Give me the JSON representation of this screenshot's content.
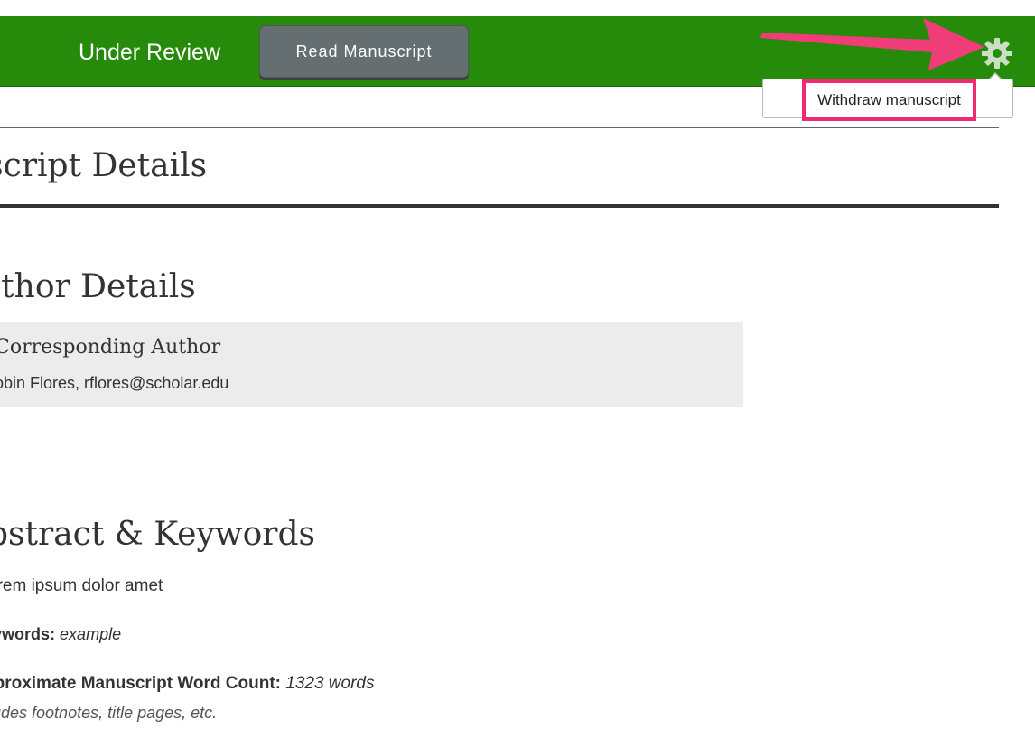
{
  "header": {
    "status": "Under Review",
    "read_button": "Read Manuscript",
    "gear_icon": "gear-icon",
    "bar_color": "#268a0a"
  },
  "menu": {
    "withdraw_label": "Withdraw manuscript",
    "highlight_color": "#ee2a74"
  },
  "annotation": {
    "arrow_color": "#f03c78"
  },
  "details": {
    "title": "uscript Details",
    "author_section": "uthor Details",
    "corresponding_label": "Corresponding Author",
    "author_line": "obin Flores, rflores@scholar.edu"
  },
  "abstract": {
    "title": "bstract & Keywords",
    "text": "orem ipsum dolor amet",
    "keywords_label": "eywords:",
    "keywords_value": "example",
    "wordcount_label": "pproximate Manuscript Word Count:",
    "wordcount_value": "1323 words",
    "note": "cludes footnotes, title pages, etc."
  }
}
